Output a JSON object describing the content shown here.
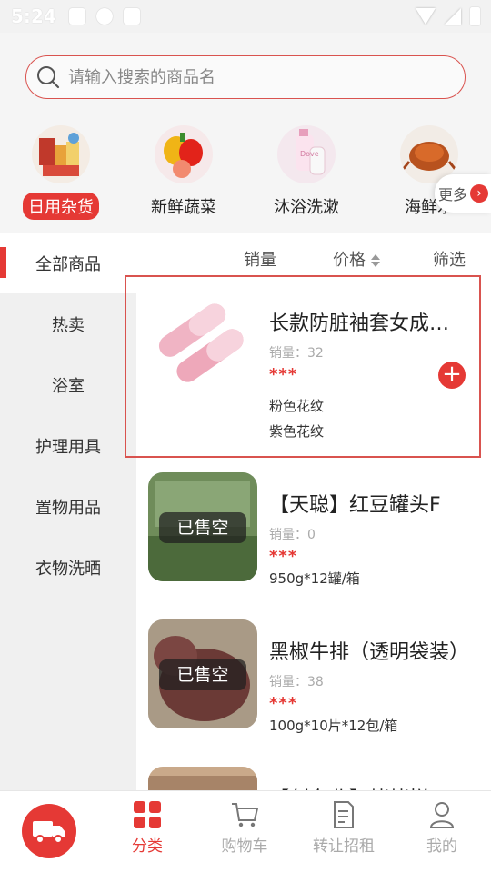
{
  "status_bar": {
    "time": "5:24"
  },
  "search": {
    "placeholder": "请输入搜索的商品名"
  },
  "top_categories": [
    {
      "label": "日用杂货",
      "active": true
    },
    {
      "label": "新鲜蔬菜",
      "active": false
    },
    {
      "label": "沐浴洗漱",
      "active": false
    },
    {
      "label": "海鲜水",
      "active": false
    }
  ],
  "more": {
    "label": "更多"
  },
  "sidebar": {
    "items": [
      {
        "label": "全部商品",
        "active": true
      },
      {
        "label": "热卖"
      },
      {
        "label": "浴室"
      },
      {
        "label": "护理用具"
      },
      {
        "label": "置物用品"
      },
      {
        "label": "衣物洗晒"
      }
    ]
  },
  "sort_bar": {
    "sales": "销量",
    "price": "价格",
    "filter": "筛选"
  },
  "products": [
    {
      "name": "长款防脏袖套女成年女士",
      "sales": "销量：32",
      "price": "***",
      "specs": [
        "粉色花纹",
        "紫色花纹"
      ],
      "sold_out": ""
    },
    {
      "name": "【天聪】红豆罐头F",
      "sales": "销量：0",
      "price": "***",
      "specs": [
        "950g*12罐/箱"
      ],
      "sold_out": "已售空"
    },
    {
      "name": "黑椒牛排（透明袋装）",
      "sales": "销量：38",
      "price": "***",
      "specs": [
        "100g*10片*12包/箱"
      ],
      "sold_out": "已售空"
    },
    {
      "name": "【创东北】烤烤拼",
      "sales": "",
      "price": "",
      "specs": [],
      "sold_out": ""
    }
  ],
  "bottom_nav": {
    "items": [
      {
        "label": "分类",
        "active": true
      },
      {
        "label": "购物车"
      },
      {
        "label": "转让招租"
      },
      {
        "label": "我的"
      }
    ]
  },
  "colors": {
    "accent": "#e53935",
    "highlight_border": "#d9534f"
  }
}
